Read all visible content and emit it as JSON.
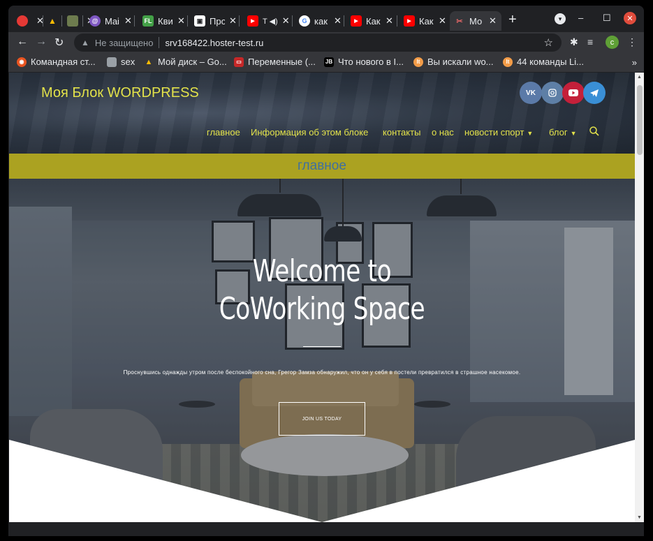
{
  "browser": {
    "tabs": [
      {
        "label": "",
        "favicon_color": "#e53935",
        "favicon_glyph": "",
        "icon": "pokeball-icon"
      },
      {
        "label": "",
        "favicon_color": "#1e8e3e",
        "favicon_glyph": "▲",
        "icon": "google-drive-icon"
      },
      {
        "label": "",
        "favicon_color": "#6d7b4e",
        "favicon_glyph": "",
        "icon": "image-icon"
      },
      {
        "label": "Mai",
        "favicon_color": "#7e57c2",
        "favicon_glyph": "@",
        "icon": "mail-icon"
      },
      {
        "label": "Кви",
        "favicon_color": "#43a047",
        "favicon_glyph": "FL",
        "icon": "fl-icon"
      },
      {
        "label": "Про",
        "favicon_color": "#ffffff",
        "favicon_glyph": "",
        "icon": "doc-icon"
      },
      {
        "label": "",
        "favicon_color": "#ff0000",
        "favicon_glyph": "▶",
        "icon": "youtube-icon",
        "audio": true
      },
      {
        "label": "как",
        "favicon_color": "#ffffff",
        "favicon_glyph": "G",
        "icon": "google-icon"
      },
      {
        "label": "Как",
        "favicon_color": "#ff0000",
        "favicon_glyph": "▶",
        "icon": "youtube-icon"
      },
      {
        "label": "Как",
        "favicon_color": "#ff0000",
        "favicon_glyph": "▶",
        "icon": "youtube-icon"
      },
      {
        "label": "Мо",
        "favicon_color": "#35363a",
        "favicon_glyph": "✂",
        "icon": "site-icon",
        "active": true
      }
    ],
    "new_tab_glyph": "+",
    "insecure_label": "Не защищено",
    "url": "srv168422.hoster-test.ru",
    "profile_initial": "c",
    "bookmarks": [
      {
        "label": "Командная ст...",
        "color": "#e95420",
        "glyph": "◉",
        "icon": "ubuntu-icon"
      },
      {
        "label": "sex",
        "color": "#9aa0a6",
        "glyph": "▬",
        "icon": "folder-icon"
      },
      {
        "label": "Мой диск – Go...",
        "color": "#1e8e3e",
        "glyph": "▲",
        "icon": "google-drive-icon"
      },
      {
        "label": "Переменные (...",
        "color": "#c62828",
        "glyph": "▭",
        "icon": "oracle-icon"
      },
      {
        "label": "Что нового в I...",
        "color": "#000000",
        "glyph": "JB",
        "icon": "jetbrains-icon"
      },
      {
        "label": "Вы искали wo...",
        "color": "#f39c48",
        "glyph": "lt",
        "icon": "lt-icon"
      },
      {
        "label": "44 команды Li...",
        "color": "#f39c48",
        "glyph": "lt",
        "icon": "lt-icon"
      }
    ],
    "bookmarks_more": "»"
  },
  "site": {
    "title": "Моя Блок WORDPRESS",
    "social": [
      {
        "label": "VK",
        "color": "#5b7aa8",
        "icon": "vk-icon"
      },
      {
        "label": "◎",
        "color": "#5e7fa6",
        "icon": "instagram-icon"
      },
      {
        "label": "▶",
        "color": "#c4203a",
        "icon": "youtube-icon"
      },
      {
        "label": "➤",
        "color": "#3a8fd6",
        "icon": "telegram-icon"
      }
    ],
    "nav": [
      {
        "label": "главное",
        "dropdown": false
      },
      {
        "label": "Информация об этом блоке",
        "dropdown": false
      },
      {
        "label": "контакты",
        "dropdown": false
      },
      {
        "label": "о нас",
        "dropdown": false
      },
      {
        "label": "новости спорт",
        "dropdown": true
      },
      {
        "label": "блог",
        "dropdown": true
      }
    ],
    "accent": "#e3e24a",
    "page_title": "главное",
    "page_title_bar_color": "#aba221",
    "hero": {
      "title_line1": "Welcome to",
      "title_line2": "CoWorking Space",
      "text": "Проснувшись однажды утром после беспокойного сна, Грегор Замза обнаружил, что он у себя в постели превратился в страшное насекомое.",
      "button": "JOIN US TODAY"
    }
  }
}
